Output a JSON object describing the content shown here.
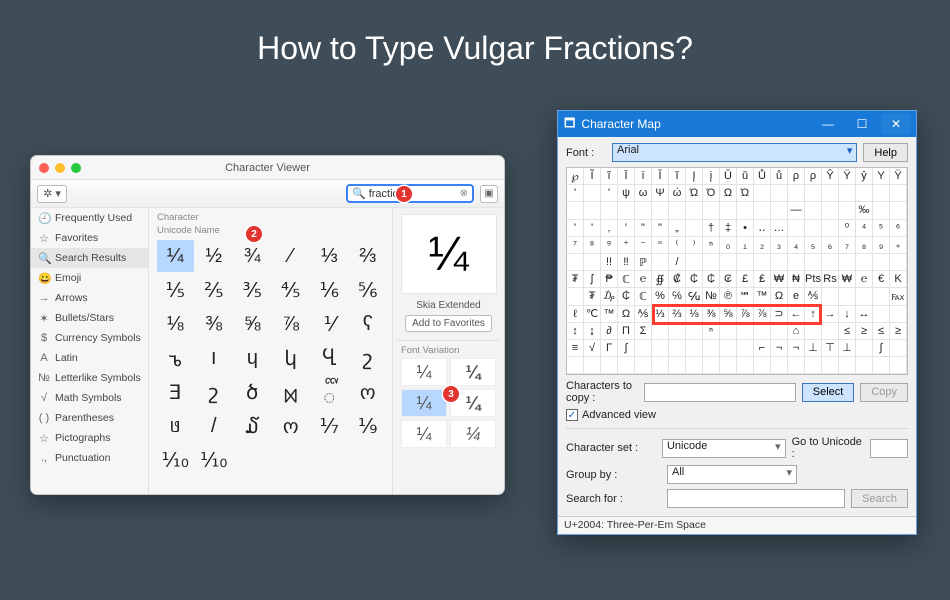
{
  "page": {
    "title": "How to Type Vulgar Fractions?"
  },
  "callouts": {
    "b1": "1",
    "b2": "2",
    "b3": "3"
  },
  "mac": {
    "window_title": "Character Viewer",
    "gear": "✲ ▾",
    "search": {
      "value": "fraction",
      "mag": "🔍",
      "clear": "⊗"
    },
    "collapse": "▣",
    "sidebar": [
      {
        "icon": "🕘",
        "label": "Frequently Used"
      },
      {
        "icon": "☆",
        "label": "Favorites"
      },
      {
        "icon": "🔍",
        "label": "Search Results",
        "selected": true
      },
      {
        "icon": "😀",
        "label": "Emoji"
      },
      {
        "icon": "→",
        "label": "Arrows"
      },
      {
        "icon": "✶",
        "label": "Bullets/Stars"
      },
      {
        "icon": "$",
        "label": "Currency Symbols"
      },
      {
        "icon": "A",
        "label": "Latin"
      },
      {
        "icon": "№",
        "label": "Letterlike Symbols"
      },
      {
        "icon": "√",
        "label": "Math Symbols"
      },
      {
        "icon": "( )",
        "label": "Parentheses"
      },
      {
        "icon": "☆",
        "label": "Pictographs"
      },
      {
        "icon": ".,",
        "label": "Punctuation"
      }
    ],
    "list_header": "Character",
    "list_header2": "Unicode Name",
    "grid": [
      "¼",
      "½",
      "¾",
      "⁄",
      "⅓",
      "⅔",
      "⅕",
      "⅖",
      "⅗",
      "⅘",
      "⅙",
      "⅚",
      "⅛",
      "⅜",
      "⅝",
      "⅞",
      "⅟",
      "ʕ",
      "ꭌ",
      "ו",
      "ɥ",
      "կ",
      "Ⴁ",
      "շ",
      "ⴺ",
      "շ",
      "ծ",
      "ᢂ",
      "ᢅ",
      "ო",
      "ᥳ",
      "/",
      "໓",
      "ო",
      "⅐",
      "⅑",
      "⅒",
      "⅒",
      "",
      "",
      "",
      ""
    ],
    "selected_grid_index": 0,
    "preview": {
      "glyph": "¼",
      "font": "Skia Extended",
      "fav": "Add to Favorites",
      "variation_header": "Font Variation",
      "variations": [
        "¼",
        "¼",
        "¼",
        "¼",
        "¼",
        "¼"
      ]
    }
  },
  "win": {
    "title": "Character Map",
    "min": "—",
    "max": "☐",
    "close": "✕",
    "font_label": "Font :",
    "font_value": "Arial",
    "help": "Help",
    "grid": [
      "℘",
      "Ĩ",
      "ĩ",
      "Ī",
      "ī",
      "Ĭ",
      "ĭ",
      "Į",
      "į",
      "Ŭ",
      "ŭ",
      "Ů",
      "ů",
      "ρ",
      "ρ",
      "Ŷ",
      "Ÿ",
      "ŷ",
      "Y",
      "Ÿ",
      "'",
      "",
      "'",
      "ψ",
      "ω",
      "Ψ",
      "ώ",
      "Ώ",
      "Ό",
      "Ω",
      "Ώ",
      "",
      "",
      "",
      "",
      "",
      "",
      "",
      "",
      "",
      "",
      "",
      "",
      "",
      "",
      "",
      "",
      "",
      "",
      "",
      "",
      "",
      "",
      "—",
      "",
      "",
      "",
      "‰",
      "",
      "",
      "'",
      "'",
      "‚",
      "‛",
      "\"",
      "\"",
      "„",
      "",
      "†",
      "‡",
      "•",
      "‥",
      "…",
      "",
      "",
      "",
      "⁰",
      "⁴",
      "⁵",
      "⁶",
      "⁷",
      "⁸",
      "⁹",
      "⁺",
      "⁻",
      "⁼",
      "⁽",
      "⁾",
      "ⁿ",
      "₀",
      "₁",
      "₂",
      "₃",
      "₄",
      "₅",
      "₆",
      "₇",
      "₈",
      "₉",
      "₊",
      "",
      "",
      "!!",
      "‼",
      "ℙ",
      "",
      "/",
      "",
      "",
      "",
      "",
      "",
      "",
      "",
      "",
      "",
      "",
      "",
      "",
      "",
      "₮",
      "∫",
      "₱",
      "ℂ",
      "℮",
      "∯",
      "₡",
      "₵",
      "₵",
      "₢",
      "£",
      "₤",
      "₩",
      "₦",
      "Pts",
      "Rs",
      "₩",
      "℮",
      "€",
      "K",
      "",
      "₮",
      "₯",
      "₵",
      "ℂ",
      "%",
      "℅",
      "℆",
      "№",
      "℗",
      "℠",
      "™",
      "Ω",
      "e",
      "⅍",
      "",
      "",
      "",
      "",
      "℻",
      "ℓ",
      "℃",
      "™",
      "Ω",
      "⅍",
      "⅓",
      "⅔",
      "⅛",
      "⅜",
      "⅝",
      "⅞",
      "⅞",
      "⊃",
      "←",
      "↑",
      "→",
      "↓",
      "↔",
      "",
      "",
      "↕",
      "↨",
      "∂",
      "Π",
      "Σ",
      "",
      "",
      "",
      "ⁿ",
      "",
      "",
      "",
      "",
      "⌂",
      "",
      "",
      "≤",
      "≥",
      "≤",
      "≥",
      "≡",
      "√",
      "Γ",
      "∫",
      "",
      "",
      "",
      "",
      "",
      "",
      "",
      "⌐",
      "¬",
      "¬",
      "⊥",
      "⊤",
      "⊥",
      "",
      "∫",
      "",
      "",
      "",
      "",
      "",
      "",
      "",
      "",
      "",
      "",
      "",
      "",
      "",
      "",
      "",
      "",
      "",
      "",
      "",
      "",
      ""
    ],
    "highlight": {
      "row": 8,
      "colStart": 5,
      "colEnd": 14
    },
    "copy_label": "Characters to copy :",
    "copy_value": "",
    "select_btn": "Select",
    "copy_btn": "Copy",
    "advanced": "Advanced view",
    "charset_label": "Character set :",
    "charset_value": "Unicode",
    "goto_label": "Go to Unicode :",
    "goto_value": "",
    "group_label": "Group by :",
    "group_value": "All",
    "search_label": "Search for :",
    "search_value": "",
    "search_btn": "Search",
    "status": "U+2004: Three-Per-Em Space"
  }
}
